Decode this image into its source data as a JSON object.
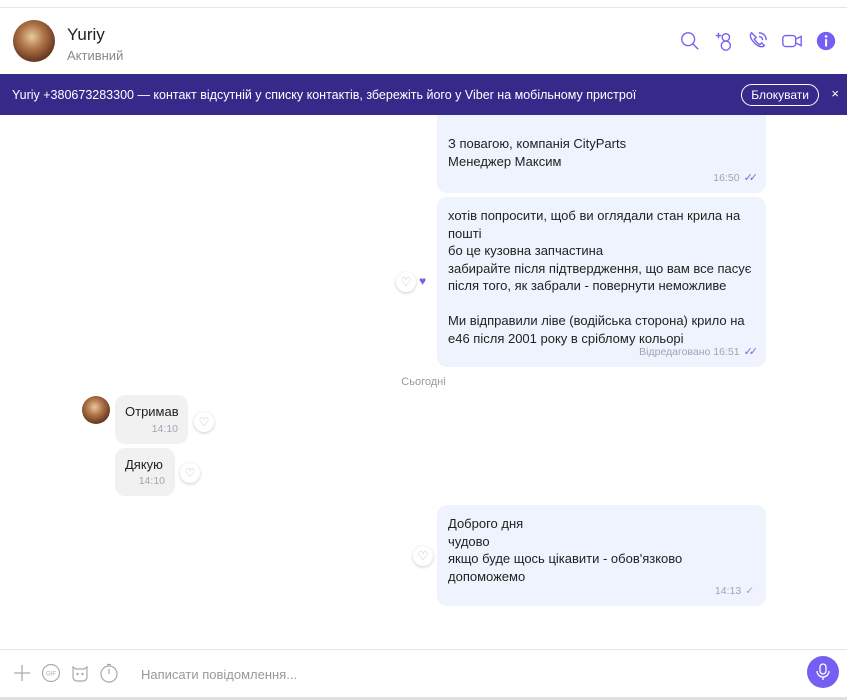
{
  "header": {
    "name": "Yuriy",
    "status": "Активний"
  },
  "banner": {
    "text": "Yuriy +380673283300 — контакт відсутній у списку контактів, збережіть його у Viber на мобільному пристрої",
    "block_label": "Блокувати",
    "close": "×"
  },
  "messages": [
    {
      "dir": "out",
      "lines": "З повагою, компанія CityParts\nМенеджер Максим",
      "time": "16:50"
    },
    {
      "dir": "out",
      "lines": "хотів попросити, щоб ви оглядали стан крила на пошті\nбо це кузовна запчастина\nзабирайте після підтвердження, що вам все пасує\nпісля того, як забрали - повернути неможливе\n\n Ми відправили ліве (водійська сторона) крило на е46 після 2001 року в сріблому кольорі",
      "time": "Відредаговано 16:51"
    },
    {
      "dir": "in",
      "lines": "Отримав",
      "time": "14:10"
    },
    {
      "dir": "in",
      "lines": "Дякую",
      "time": "14:10"
    },
    {
      "dir": "out",
      "lines": "Доброго дня\nчудово\nякщо буде щось цікавити - обов'язково допоможемо",
      "time": "14:13"
    }
  ],
  "date_divider": "Сьогодні",
  "input": {
    "placeholder": "Написати повідомлення..."
  },
  "colors": {
    "accent": "#7360f2",
    "banner": "#352a8a",
    "bubble_out": "#eef3fd"
  }
}
